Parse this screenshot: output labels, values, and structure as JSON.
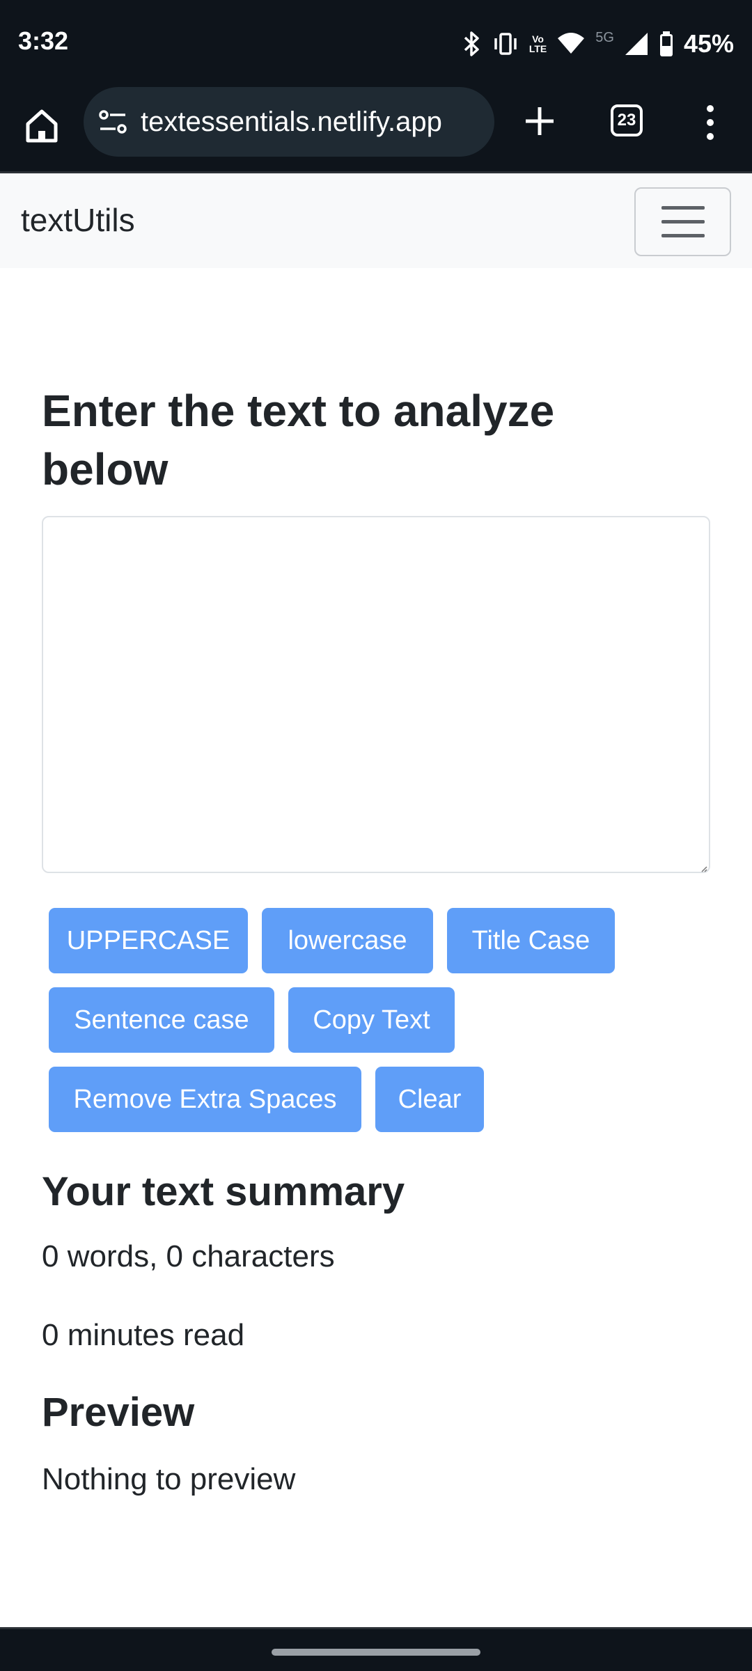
{
  "status_bar": {
    "time": "3:32",
    "network_label": "5G",
    "volte_label_top": "Vo",
    "volte_label_bottom": "LTE",
    "battery": "45%",
    "icons": [
      "bluetooth-icon",
      "vibrate-icon",
      "volte-icon",
      "wifi-icon",
      "signal-icon",
      "battery-icon"
    ]
  },
  "browser": {
    "url": "textessentials.netlify.app",
    "tab_count": "23",
    "icons": [
      "home-icon",
      "site-info-icon",
      "new-tab-icon",
      "tabs-icon",
      "more-menu-icon"
    ]
  },
  "navbar": {
    "brand": "textUtils",
    "toggler_icon": "hamburger-icon"
  },
  "main": {
    "heading": "Enter the text to analyze below",
    "textarea_value": "",
    "buttons": {
      "uppercase": "UPPERCASE",
      "lowercase": "lowercase",
      "title_case": "Title Case",
      "sentence_case": "Sentence case",
      "copy_text": "Copy Text",
      "remove_spaces": "Remove Extra Spaces",
      "clear": "Clear"
    },
    "summary_title": "Your text summary",
    "word_char_count": "0 words, 0 characters",
    "read_time": "0 minutes read",
    "preview_title": "Preview",
    "preview_text": "Nothing to preview"
  },
  "colors": {
    "button_bg": "#5f9ef8",
    "chrome_bg": "#0e141b",
    "navbar_bg": "#f8f9fa"
  }
}
